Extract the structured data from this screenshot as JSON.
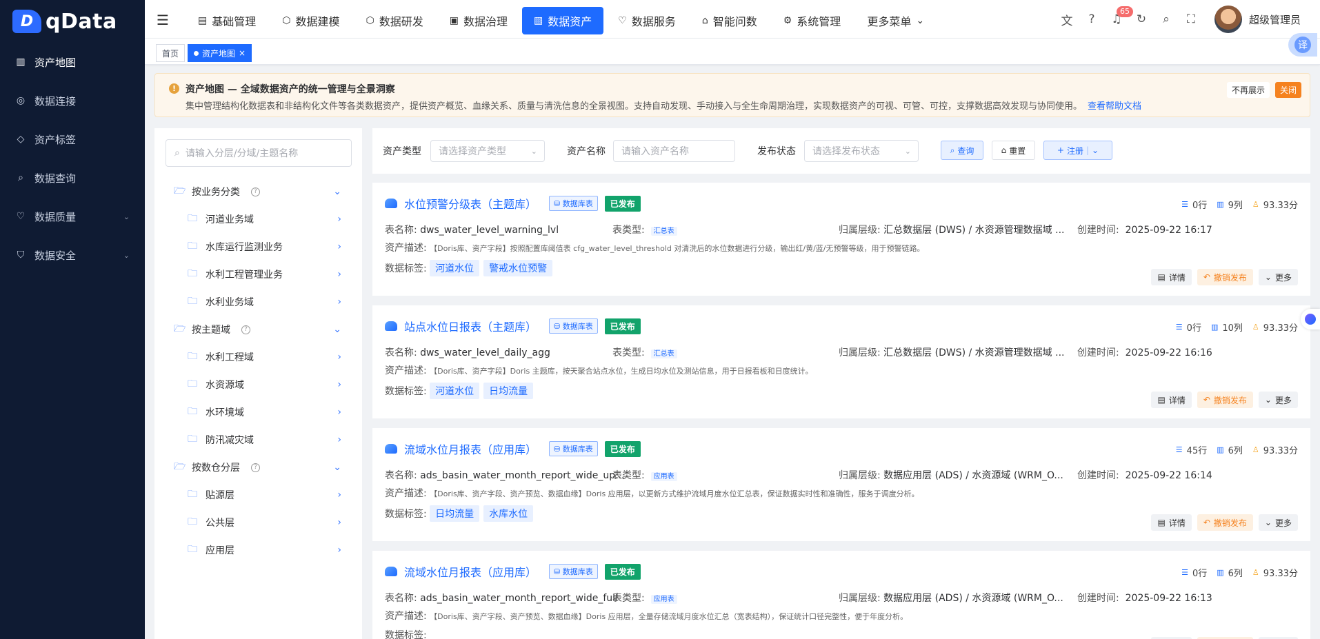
{
  "app": {
    "name": "qData"
  },
  "sidebar": {
    "items": [
      {
        "label": "资产地图",
        "icon": "map-icon",
        "active": true
      },
      {
        "label": "数据连接",
        "icon": "connection-icon"
      },
      {
        "label": "资产标签",
        "icon": "tag-icon"
      },
      {
        "label": "数据查询",
        "icon": "search-icon"
      },
      {
        "label": "数据质量",
        "icon": "quality-icon",
        "expandable": true
      },
      {
        "label": "数据安全",
        "icon": "shield-icon",
        "expandable": true
      }
    ]
  },
  "topnav": {
    "items": [
      {
        "label": "基础管理"
      },
      {
        "label": "数据建模"
      },
      {
        "label": "数据研发"
      },
      {
        "label": "数据治理"
      },
      {
        "label": "数据资产",
        "active": true
      },
      {
        "label": "数据服务"
      },
      {
        "label": "智能问数"
      },
      {
        "label": "系统管理"
      },
      {
        "label": "更多菜单"
      }
    ],
    "notification_count": "65",
    "username": "超级管理员",
    "translate_label": "译"
  },
  "tabs": {
    "home": "首页",
    "current": "资产地图",
    "close": "×"
  },
  "notice": {
    "icon": "!",
    "title": "资产地图 — 全域数据资产的统一管理与全景洞察",
    "desc": "集中管理结构化数据表和非结构化文件等各类数据资产，提供资产概览、血缘关系、质量与清洗信息的全景视图。支持自动发现、手动接入与全生命周期治理，实现数据资产的可视、可管、可控，支撑数据高效发现与协同使用。",
    "help_link": "查看帮助文档",
    "hide_label": "不再展示",
    "close_label": "关闭"
  },
  "tree": {
    "search_placeholder": "请输入分层/分域/主题名称",
    "groups": [
      {
        "label": "按业务分类",
        "children": [
          "河道业务域",
          "水库运行监测业务",
          "水利工程管理业务",
          "水利业务域"
        ]
      },
      {
        "label": "按主题域",
        "children": [
          "水利工程域",
          "水资源域",
          "水环境域",
          "防汛减灾域"
        ]
      },
      {
        "label": "按数仓分层",
        "children": [
          "贴源层",
          "公共层",
          "应用层"
        ]
      }
    ]
  },
  "filter": {
    "type_label": "资产类型",
    "type_placeholder": "请选择资产类型",
    "name_label": "资产名称",
    "name_placeholder": "请输入资产名称",
    "status_label": "发布状态",
    "status_placeholder": "请选择发布状态",
    "query_button": "查询",
    "reset_button": "重置",
    "register_button": "注册"
  },
  "card_labels": {
    "table_name": "表名称:",
    "table_type": "表类型:",
    "level": "归属层级:",
    "created": "创建时间:",
    "desc": "资产描述:",
    "tags": "数据标签:",
    "detail": "详情",
    "revoke": "撤销发布",
    "more": "更多",
    "db_tag": "数据库表",
    "published": "已发布"
  },
  "cards": [
    {
      "title": "水位预警分级表（主题库）",
      "rows": "0行",
      "cols": "9列",
      "score": "93.33分",
      "table_name": "dws_water_level_warning_lvl",
      "table_type": "汇总表",
      "level": "汇总数据层 (DWS) / 水资源管理数据域 ...",
      "created": "2025-09-22 16:17",
      "desc": "【Doris库、资产字段】按照配置库阈值表 cfg_water_level_threshold 对清洗后的水位数据进行分级，输出红/黄/蓝/无预警等级，用于预警链路。",
      "tags": [
        "河道水位",
        "警戒水位预警"
      ]
    },
    {
      "title": "站点水位日报表（主题库）",
      "rows": "0行",
      "cols": "10列",
      "score": "93.33分",
      "table_name": "dws_water_level_daily_agg",
      "table_type": "汇总表",
      "level": "汇总数据层 (DWS) / 水资源管理数据域 ...",
      "created": "2025-09-22 16:16",
      "desc": "【Doris库、资产字段】Doris 主题库，按天聚合站点水位，生成日均水位及测站信息，用于日报看板和日度统计。",
      "tags": [
        "河道水位",
        "日均流量"
      ]
    },
    {
      "title": "流域水位月报表（应用库）",
      "rows": "45行",
      "cols": "6列",
      "score": "93.33分",
      "table_name": "ads_basin_water_month_report_wide_up...",
      "table_type": "应用表",
      "level": "数据应用层 (ADS) / 水资源域 (WRM_O...",
      "created": "2025-09-22 16:14",
      "desc": "【Doris库、资产字段、资产预览、数据血缘】Doris 应用层，以更新方式维护流域月度水位汇总表，保证数据实时性和准确性，服务于调度分析。",
      "tags": [
        "日均流量",
        "水库水位"
      ]
    },
    {
      "title": "流域水位月报表（应用库）",
      "rows": "0行",
      "cols": "6列",
      "score": "93.33分",
      "table_name": "ads_basin_water_month_report_wide_full",
      "table_type": "应用表",
      "level": "数据应用层 (ADS) / 水资源域 (WRM_O...",
      "created": "2025-09-22 16:13",
      "desc": "【Doris库、资产字段、资产预览、数据血缘】Doris 应用层，全量存储流域月度水位汇总（宽表结构），保证统计口径完整性，便于年度分析。",
      "tags": []
    }
  ]
}
